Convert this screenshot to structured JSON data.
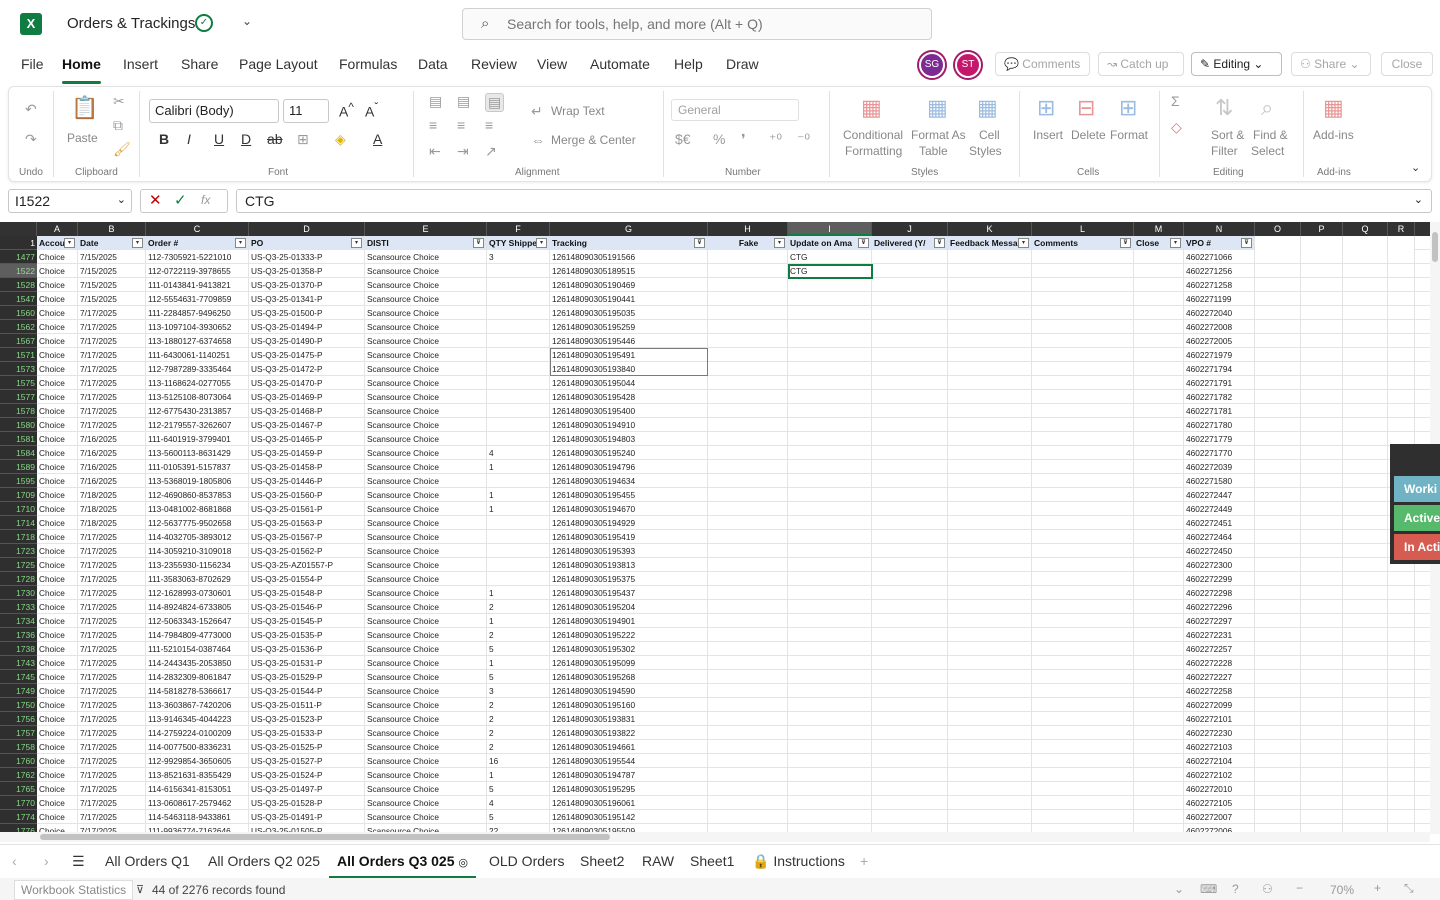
{
  "title": {
    "app_logo": "X",
    "doc_name": "Orders & Trackings",
    "search_placeholder": "Search for tools, help, and more (Alt + Q)"
  },
  "menu": [
    "File",
    "Home",
    "Insert",
    "Share",
    "Page Layout",
    "Formulas",
    "Data",
    "Review",
    "View",
    "Automate",
    "Help",
    "Draw"
  ],
  "avatars": [
    {
      "initials": "SG",
      "color": "#7b2b91"
    },
    {
      "initials": "ST",
      "color": "#c6186b"
    }
  ],
  "top_buttons": {
    "comments": "Comments",
    "catchup": "Catch up",
    "editing": "Editing",
    "share": "Share",
    "close": "Close"
  },
  "ribbon": {
    "undo_label": "Undo",
    "paste": "Paste",
    "clipboard": "Clipboard",
    "font_name": "Calibri (Body)",
    "font_size": "11",
    "font": "Font",
    "wrap": "Wrap Text",
    "merge": "Merge & Center",
    "alignment": "Alignment",
    "number_format": "General",
    "number": "Number",
    "conditional": "Conditional",
    "formatting": "Formatting",
    "format_as": "Format As",
    "table": "Table",
    "cell": "Cell",
    "styles_btn": "Styles",
    "styles": "Styles",
    "insert": "Insert",
    "delete": "Delete",
    "format": "Format",
    "cells": "Cells",
    "sort": "Sort &",
    "filter": "Filter",
    "find": "Find &",
    "select": "Select",
    "editing": "Editing",
    "addins": "Add-ins",
    "addins_group": "Add-ins"
  },
  "formula_bar": {
    "name_box": "I1522",
    "fx": "fx",
    "formula": "CTG"
  },
  "columns": [
    {
      "letter": "A",
      "header": "Accou",
      "filter": "▾"
    },
    {
      "letter": "B",
      "header": "Date",
      "filter": "▾"
    },
    {
      "letter": "C",
      "header": "Order #",
      "filter": "▾"
    },
    {
      "letter": "D",
      "header": "PO",
      "filter": "▾"
    },
    {
      "letter": "E",
      "header": "DISTI",
      "filter": "⊽"
    },
    {
      "letter": "F",
      "header": "QTY Shippe",
      "filter": "▾"
    },
    {
      "letter": "G",
      "header": "Tracking",
      "filter": "⊽"
    },
    {
      "letter": "H",
      "header": "Fake",
      "filter": "▾"
    },
    {
      "letter": "I",
      "header": "Update on Ama",
      "filter": "⊽"
    },
    {
      "letter": "J",
      "header": "Delivered (Y/",
      "filter": "⊽"
    },
    {
      "letter": "K",
      "header": "Feedback Messa",
      "filter": "▾"
    },
    {
      "letter": "L",
      "header": "Comments",
      "filter": "⊽"
    },
    {
      "letter": "M",
      "header": "Close",
      "filter": "▾"
    },
    {
      "letter": "N",
      "header": "VPO #",
      "filter": "⊽"
    },
    {
      "letter": "O",
      "header": "",
      "filter": ""
    },
    {
      "letter": "P",
      "header": "",
      "filter": ""
    },
    {
      "letter": "Q",
      "header": "",
      "filter": ""
    },
    {
      "letter": "R",
      "header": "",
      "filter": ""
    }
  ],
  "header_row_num": "1",
  "rows": [
    [
      "1477",
      "Choice",
      "7/15/2025",
      "112-7305921-5221010",
      "US-Q3-25-01333-P",
      "Scansource Choice",
      "3",
      "126148090305191566",
      "",
      "CTG",
      "4602271066"
    ],
    [
      "1522",
      "Choice",
      "7/15/2025",
      "112-0722119-3978655",
      "US-Q3-25-01358-P",
      "Scansource Choice",
      "",
      "126148090305189515",
      "",
      "CTG",
      "4602271256"
    ],
    [
      "1528",
      "Choice",
      "7/15/2025",
      "111-0143841-9413821",
      "US-Q3-25-01370-P",
      "Scansource Choice",
      "",
      "126148090305190469",
      "",
      "",
      "4602271258"
    ],
    [
      "1547",
      "Choice",
      "7/15/2025",
      "112-5554631-7709859",
      "US-Q3-25-01341-P",
      "Scansource Choice",
      "",
      "126148090305190441",
      "",
      "",
      "    4602271199"
    ],
    [
      "1560",
      "Choice",
      "7/17/2025",
      "111-2284857-9496250",
      "US-Q3-25-01500-P",
      "Scansource Choice",
      "",
      "126148090305195035",
      "",
      "",
      "4602272040"
    ],
    [
      "1562",
      "Choice",
      "7/17/2025",
      "113-1097104-3930652",
      "US-Q3-25-01494-P",
      "Scansource Choice",
      "",
      "126148090305195259",
      "",
      "",
      "4602272008"
    ],
    [
      "1567",
      "Choice",
      "7/17/2025",
      "113-1880127-6374658",
      "US-Q3-25-01490-P",
      "Scansource Choice",
      "",
      "126148090305195446",
      "",
      "",
      "4602272005"
    ],
    [
      "1571",
      "Choice",
      "7/17/2025",
      "111-6430061-1140251",
      "US-Q3-25-01475-P",
      "Scansource Choice",
      "",
      "126148090305195491",
      "",
      "",
      "4602271979"
    ],
    [
      "1573",
      "Choice",
      "7/17/2025",
      "112-7987289-3335464",
      "US-Q3-25-01472-P",
      "Scansource Choice",
      "",
      "126148090305193840",
      "",
      "",
      "4602271794"
    ],
    [
      "1575",
      "Choice",
      "7/17/2025",
      "113-1168624-0277055",
      "US-Q3-25-01470-P",
      "Scansource Choice",
      "",
      "126148090305195044",
      "",
      "",
      "4602271791"
    ],
    [
      "1577",
      "Choice",
      "7/17/2025",
      "113-5125108-8073064",
      "US-Q3-25-01469-P",
      "Scansource Choice",
      "",
      "126148090305195428",
      "",
      "",
      "4602271782"
    ],
    [
      "1578",
      "Choice",
      "7/17/2025",
      "112-6775430-2313857",
      "US-Q3-25-01468-P",
      "Scansource Choice",
      "",
      "126148090305195400",
      "",
      "",
      "4602271781"
    ],
    [
      "1580",
      "Choice",
      "7/17/2025",
      "112-2179557-3262607",
      "US-Q3-25-01467-P",
      "Scansource Choice",
      "",
      "126148090305194910",
      "",
      "",
      "4602271780"
    ],
    [
      "1581",
      "Choice",
      "7/16/2025",
      "111-6401919-3799401",
      "US-Q3-25-01465-P",
      "Scansource Choice",
      "",
      "126148090305194803",
      "",
      "",
      "4602271779"
    ],
    [
      "1584",
      "Choice",
      "7/16/2025",
      "113-5600113-8631429",
      "US-Q3-25-01459-P",
      "Scansource Choice",
      "4",
      "126148090305195240",
      "",
      "",
      "4602271770"
    ],
    [
      "1589",
      "Choice",
      "7/16/2025",
      "111-0105391-5157837",
      "US-Q3-25-01458-P",
      "Scansource Choice",
      "1",
      "126148090305194796",
      "",
      "",
      "4602272039"
    ],
    [
      "1595",
      "Choice",
      "7/16/2025",
      "113-5368019-1805806",
      "US-Q3-25-01446-P",
      "Scansource Choice",
      "",
      "126148090305194634",
      "",
      "",
      "4602271580"
    ],
    [
      "1709",
      "Choice",
      "7/18/2025",
      "112-4690860-8537853",
      "US-Q3-25-01560-P",
      "Scansource Choice",
      "1",
      "126148090305195455",
      "",
      "",
      "4602272447"
    ],
    [
      "1710",
      "Choice",
      "7/18/2025",
      "113-0481002-8681868",
      "US-Q3-25-01561-P",
      "Scansource Choice",
      "1",
      "126148090305194670",
      "",
      "",
      "4602272449"
    ],
    [
      "1714",
      "Choice",
      "7/18/2025",
      "112-5637775-9502658",
      "US-Q3-25-01563-P",
      "Scansource Choice",
      "",
      "126148090305194929",
      "",
      "",
      "4602272451"
    ],
    [
      "1718",
      "Choice",
      "7/17/2025",
      "114-4032705-3893012",
      "US-Q3-25-01567-P",
      "Scansource Choice",
      "",
      "126148090305195419",
      "",
      "",
      "4602272464"
    ],
    [
      "1723",
      "Choice",
      "7/17/2025",
      "114-3059210-3109018",
      "US-Q3-25-01562-P",
      "Scansource Choice",
      "",
      "126148090305195393",
      "",
      "",
      "4602272450"
    ],
    [
      "1725",
      "Choice",
      "7/17/2025",
      "113-2355930-1156234",
      "US-Q3-25-AZ01557-P",
      "Scansource Choice",
      "",
      "126148090305193813",
      "",
      "",
      "4602272300"
    ],
    [
      "1728",
      "Choice",
      "7/17/2025",
      "111-3583063-8702629",
      "US-Q3-25-01554-P",
      "Scansource Choice",
      "",
      "126148090305195375",
      "",
      "",
      "4602272299"
    ],
    [
      "1730",
      "Choice",
      "7/17/2025",
      "112-1628993-0730601",
      "US-Q3-25-01548-P",
      "Scansource Choice",
      "1",
      "126148090305195437",
      "",
      "",
      "4602272298"
    ],
    [
      "1733",
      "Choice",
      "7/17/2025",
      "114-8924824-6733805",
      "US-Q3-25-01546-P",
      "Scansource Choice",
      "2",
      "126148090305195204",
      "",
      "",
      "4602272296"
    ],
    [
      "1734",
      "Choice",
      "7/17/2025",
      "112-5063343-1526647",
      "US-Q3-25-01545-P",
      "Scansource Choice",
      "1",
      "126148090305194901",
      "",
      "",
      "4602272297"
    ],
    [
      "1736",
      "Choice",
      "7/17/2025",
      "114-7984809-4773000",
      "US-Q3-25-01535-P",
      "Scansource Choice",
      "2",
      "126148090305195222",
      "",
      "",
      "4602272231"
    ],
    [
      "1738",
      "Choice",
      "7/17/2025",
      "111-5210154-0387464",
      "US-Q3-25-01536-P",
      "Scansource Choice",
      "5",
      "126148090305195302",
      "",
      "",
      "4602272257"
    ],
    [
      "1743",
      "Choice",
      "7/17/2025",
      "114-2443435-2053850",
      "US-Q3-25-01531-P",
      "Scansource Choice",
      "1",
      "126148090305195099",
      "",
      "",
      "4602272228"
    ],
    [
      "1745",
      "Choice",
      "7/17/2025",
      "114-2832309-8061847",
      "US-Q3-25-01529-P",
      "Scansource Choice",
      "5",
      "126148090305195268",
      "",
      "",
      "4602272227"
    ],
    [
      "1749",
      "Choice",
      "7/17/2025",
      "114-5818278-5366617",
      "US-Q3-25-01544-P",
      "Scansource Choice",
      "3",
      "126148090305194590",
      "",
      "",
      "4602272258"
    ],
    [
      "1750",
      "Choice",
      "7/17/2025",
      "113-3603867-7420206",
      "US-Q3-25-01511-P",
      "Scansource Choice",
      "2",
      "126148090305195160",
      "",
      "",
      "4602272099"
    ],
    [
      "1756",
      "Choice",
      "7/17/2025",
      "113-9146345-4044223",
      "US-Q3-25-01523-P",
      "Scansource Choice",
      "2",
      "126148090305193831",
      "",
      "",
      "4602272101"
    ],
    [
      "1757",
      "Choice",
      "7/17/2025",
      "114-2759224-0100209",
      "US-Q3-25-01533-P",
      "Scansource Choice",
      "2",
      "126148090305193822",
      "",
      "",
      "4602272230"
    ],
    [
      "1758",
      "Choice",
      "7/17/2025",
      "114-0077500-8336231",
      "US-Q3-25-01525-P",
      "Scansource Choice",
      "2",
      "126148090305194661",
      "",
      "",
      "4602272103"
    ],
    [
      "1760",
      "Choice",
      "7/17/2025",
      "112-9929854-3650605",
      "US-Q3-25-01527-P",
      "Scansource Choice",
      "16",
      "126148090305195544",
      "",
      "",
      "4602272104"
    ],
    [
      "1762",
      "Choice",
      "7/17/2025",
      "113-8521631-8355429",
      "US-Q3-25-01524-P",
      "Scansource Choice",
      "1",
      "126148090305194787",
      "",
      "",
      "4602272102"
    ],
    [
      "1765",
      "Choice",
      "7/17/2025",
      "114-6156341-8153051",
      "US-Q3-25-01497-P",
      "Scansource Choice",
      "5",
      "126148090305195295",
      "",
      "",
      "4602272010"
    ],
    [
      "1770",
      "Choice",
      "7/17/2025",
      "113-0608617-2579462",
      "US-Q3-25-01528-P",
      "Scansource Choice",
      "4",
      "126148090305196061",
      "",
      "",
      "4602272105"
    ],
    [
      "1774",
      "Choice",
      "7/17/2025",
      "114-5463118-9433861",
      "US-Q3-25-01491-P",
      "Scansource Choice",
      "5",
      "126148090305195142",
      "",
      "",
      "4602272007"
    ],
    [
      "1776",
      "Choice",
      "7/17/2025",
      "111-9936774-7162646",
      "US-Q3-25-01505-P",
      "Scansource Choice",
      "22",
      "126148090305195509",
      "",
      "",
      "4602272006"
    ]
  ],
  "side_panel": [
    {
      "label": "Worki",
      "color": "#6fb3c4"
    },
    {
      "label": "Active",
      "color": "#57b96c"
    },
    {
      "label": "In Acti",
      "color": "#d65c52"
    }
  ],
  "sheets": [
    "All Orders Q1",
    "All Orders Q2 025",
    "All Orders Q3 025",
    "OLD Orders",
    "Sheet2",
    "RAW",
    "Sheet1",
    "Instructions"
  ],
  "status": {
    "workbook": "Workbook Statistics",
    "records": "44 of 2276 records found",
    "zoom": "70%"
  }
}
